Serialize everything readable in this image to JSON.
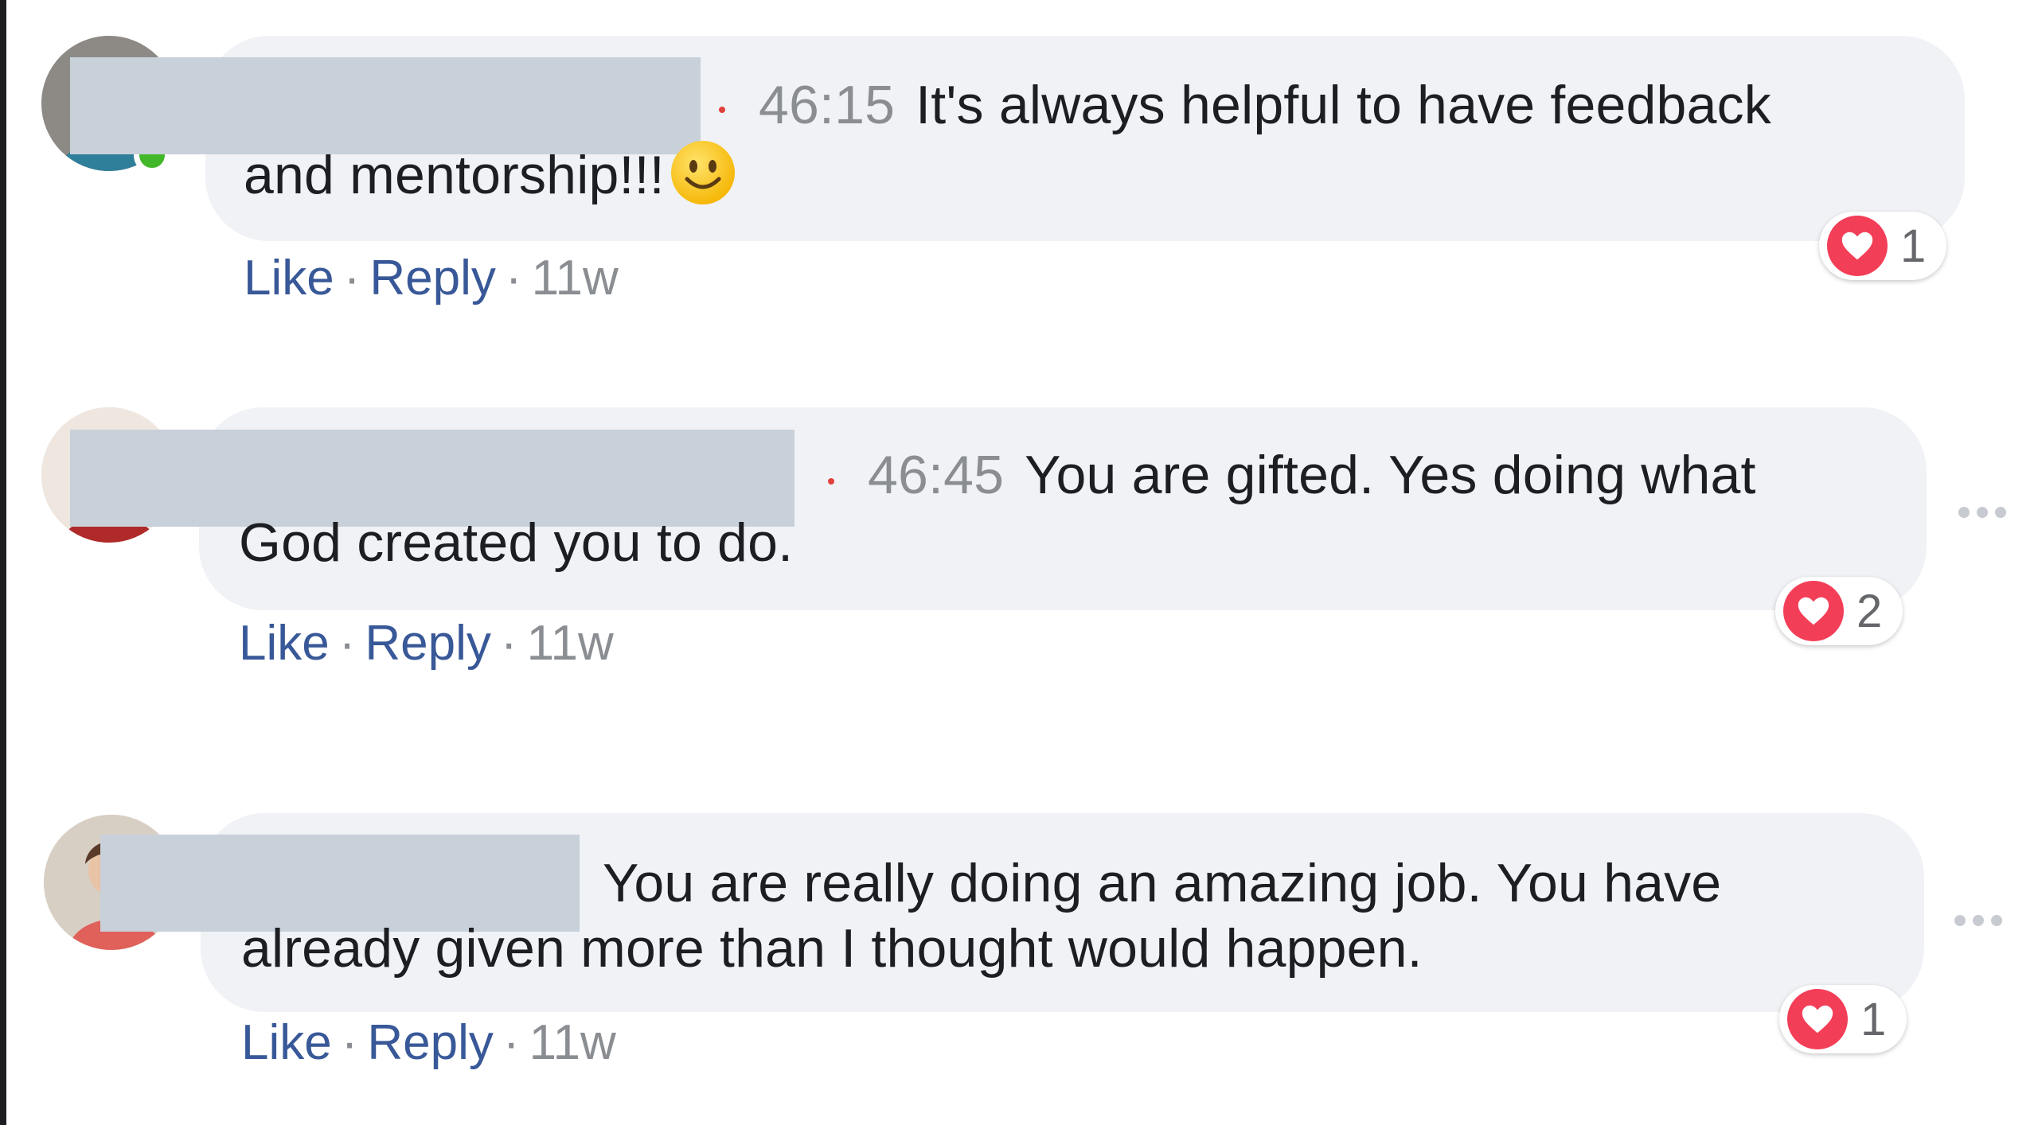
{
  "comments": [
    {
      "timestamp": "46:15",
      "line1": "It's always helpful to have feedback",
      "line2": "and mentorship!!!",
      "emoji": "smiling-face-emoji",
      "like_label": "Like",
      "reply_label": "Reply",
      "separator": "·",
      "age": "11w",
      "reaction_count": "1",
      "reaction_icon": "heart-icon",
      "author_redacted": true,
      "online": true
    },
    {
      "timestamp": "46:45",
      "line1": "You are gifted. Yes doing what",
      "line2": "God created you to do.",
      "like_label": "Like",
      "reply_label": "Reply",
      "separator": "·",
      "age": "11w",
      "reaction_count": "2",
      "reaction_icon": "heart-icon",
      "author_redacted": true
    },
    {
      "line1": "You are really doing an amazing job. You have",
      "line2": "already given more than I thought would happen.",
      "like_label": "Like",
      "reply_label": "Reply",
      "separator": "·",
      "age": "11w",
      "reaction_count": "1",
      "reaction_icon": "heart-icon",
      "author_redacted": true
    }
  ],
  "colors": {
    "link": "#385898",
    "bubble": "#f0f2f5",
    "heart": "#f33e58",
    "online": "#42b72a",
    "muted": "#8a8d91"
  }
}
